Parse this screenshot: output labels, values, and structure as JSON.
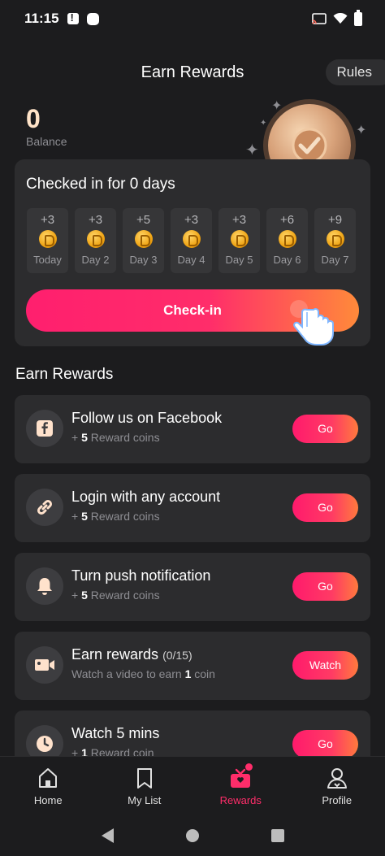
{
  "status_bar": {
    "time": "11:15"
  },
  "header": {
    "title": "Earn Rewards",
    "rules_label": "Rules"
  },
  "balance": {
    "value": "0",
    "label": "Balance"
  },
  "checkin": {
    "title": "Checked in for 0 days",
    "days": [
      {
        "amount": "+3",
        "label": "Today"
      },
      {
        "amount": "+3",
        "label": "Day 2"
      },
      {
        "amount": "+5",
        "label": "Day 3"
      },
      {
        "amount": "+3",
        "label": "Day 4"
      },
      {
        "amount": "+3",
        "label": "Day 5"
      },
      {
        "amount": "+6",
        "label": "Day 6"
      },
      {
        "amount": "+9",
        "label": "Day 7"
      }
    ],
    "button_label": "Check-in"
  },
  "earn_section": {
    "title": "Earn Rewards",
    "tasks": [
      {
        "title": "Follow us on Facebook",
        "title_extra": "",
        "sub_prefix": "+ ",
        "sub_value": "5",
        "sub_suffix": " Reward coins",
        "button": "Go",
        "icon": "facebook-icon"
      },
      {
        "title": "Login with any account",
        "title_extra": "",
        "sub_prefix": "+ ",
        "sub_value": "5",
        "sub_suffix": " Reward coins",
        "button": "Go",
        "icon": "link-icon"
      },
      {
        "title": "Turn push notification",
        "title_extra": "",
        "sub_prefix": "+ ",
        "sub_value": "5",
        "sub_suffix": " Reward coins",
        "button": "Go",
        "icon": "bell-icon"
      },
      {
        "title": "Earn rewards",
        "title_extra": "(0/15)",
        "sub_prefix": "Watch a video to earn ",
        "sub_value": "1",
        "sub_suffix": " coin",
        "button": "Watch",
        "icon": "video-icon"
      },
      {
        "title": "Watch 5 mins",
        "title_extra": "",
        "sub_prefix": "+ ",
        "sub_value": "1",
        "sub_suffix": " Reward coin",
        "button": "Go",
        "icon": "clock-icon"
      }
    ]
  },
  "bottom_nav": {
    "items": [
      {
        "label": "Home",
        "icon": "home-icon"
      },
      {
        "label": "My List",
        "icon": "bookmark-icon"
      },
      {
        "label": "Rewards",
        "icon": "gift-icon"
      },
      {
        "label": "Profile",
        "icon": "profile-icon"
      }
    ],
    "active": "Rewards"
  },
  "colors": {
    "accent": "#ff2d6a",
    "accent_end": "#ff8a3a",
    "background": "#1c1c1e",
    "card": "#2c2c2e"
  }
}
